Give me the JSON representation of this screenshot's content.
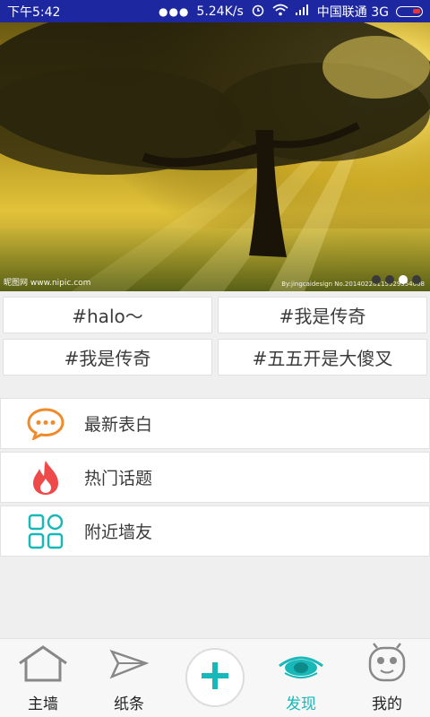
{
  "status_bar": {
    "time": "下午5:42",
    "speed": "5.24K/s",
    "carrier": "中国联通 3G"
  },
  "banner": {
    "watermark_left": "昵图网 www.nipic.com",
    "watermark_right": "By:jingcaidesign  No.20140228115929554008",
    "slide_count": 4,
    "active_slide": 3
  },
  "tags": [
    {
      "label": "#halo～"
    },
    {
      "label": "#我是传奇"
    },
    {
      "label": "#我是传奇"
    },
    {
      "label": "#五五开是大傻叉"
    }
  ],
  "menu": [
    {
      "label": "最新表白",
      "icon": "chat-bubble-icon"
    },
    {
      "label": "热门话题",
      "icon": "flame-icon"
    },
    {
      "label": "附近墙友",
      "icon": "grid-icon"
    }
  ],
  "bottom_nav": [
    {
      "label": "主墙",
      "icon": "house-icon"
    },
    {
      "label": "纸条",
      "icon": "paper-plane-icon"
    },
    {
      "label": "发现",
      "icon": "eye-icon"
    },
    {
      "label": "我的",
      "icon": "face-icon"
    }
  ],
  "colors": {
    "status_bar": "#1d27a0",
    "accent": "#19b8b8",
    "chat_orange": "#f08b2c",
    "flame_red": "#ee4a4a"
  }
}
